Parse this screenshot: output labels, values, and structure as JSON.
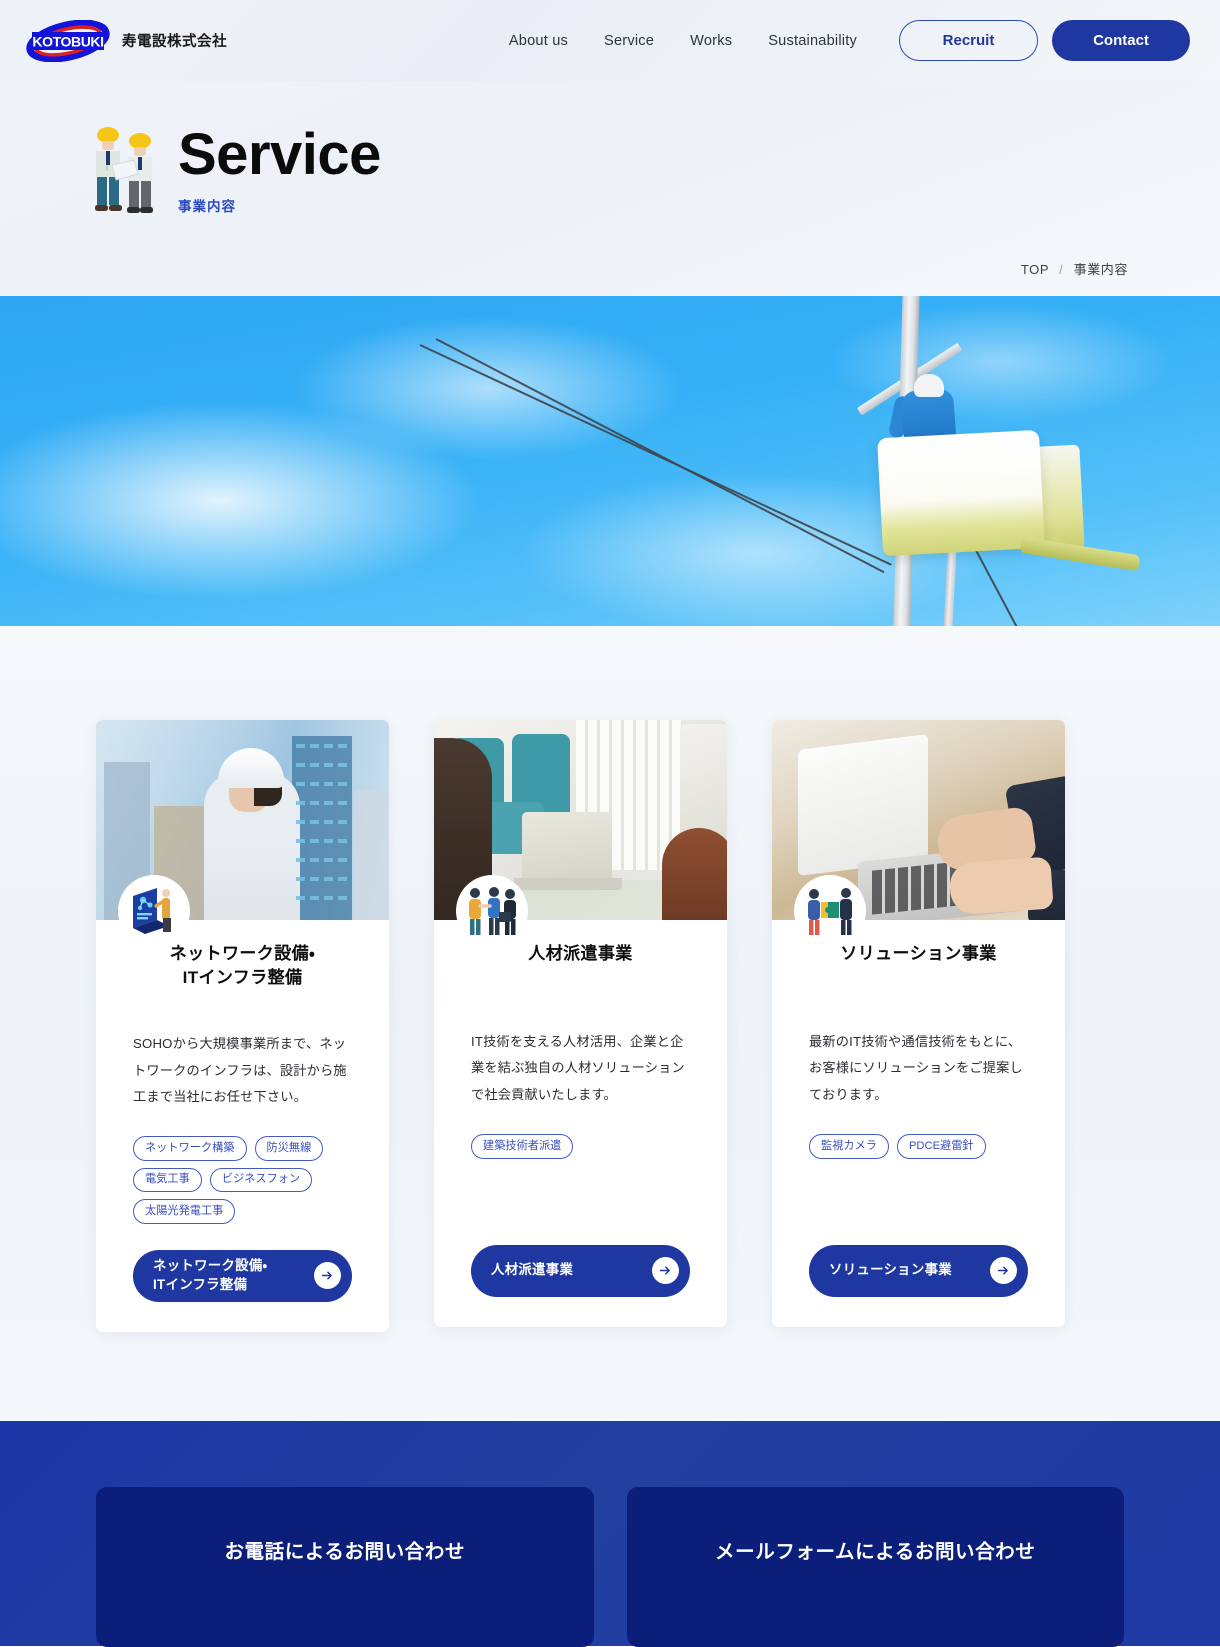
{
  "header": {
    "logo_text": "KOTOBUKI",
    "company_name": "寿電設株式会社",
    "nav": [
      {
        "label": "About us"
      },
      {
        "label": "Service"
      },
      {
        "label": "Works"
      },
      {
        "label": "Sustainability"
      }
    ],
    "recruit_label": "Recruit",
    "contact_label": "Contact"
  },
  "page_title": {
    "main": "Service",
    "sub": "事業内容"
  },
  "breadcrumb": {
    "home": "TOP",
    "separator": "/",
    "current": "事業内容"
  },
  "cards": [
    {
      "icon": "network-kiosk-icon",
      "title": "ネットワーク設備・\nITインフラ整備",
      "title_line1": "ネットワーク設備・",
      "title_line2": "ITインフラ整備",
      "description": "SOHOから大規模事業所まで、ネットワークのインフラは、設計から施工まで当社にお任せ下さい。",
      "tags": [
        "ネットワーク構築",
        "防災無線",
        "電気工事",
        "ビジネスフォン",
        "太陽光発電工事"
      ],
      "cta_line1": "ネットワーク設備・",
      "cta_line2": "ITインフラ整備",
      "photo": "worker-with-white-helmet-cityscape"
    },
    {
      "icon": "handshake-people-icon",
      "title": "人材派遣事業",
      "title_line1": "人材派遣事業",
      "title_line2": "",
      "description": "IT技術を支える人材活用、企業と企業を結ぶ独自の人材ソリューションで社会貢献いたします。",
      "tags": [
        "建築技術者派遣"
      ],
      "cta_line1": "人材派遣事業",
      "cta_line2": "",
      "photo": "meeting-room-laptop-consultation"
    },
    {
      "icon": "puzzle-people-icon",
      "title": "ソリューション事業",
      "title_line1": "ソリューション事業",
      "title_line2": "",
      "description": "最新のIT技術や通信技術をもとに、お客様にソリューションをご提案しております。",
      "tags": [
        "監視カメラ",
        "PDCE避雷針"
      ],
      "cta_line1": "ソリューション事業",
      "cta_line2": "",
      "photo": "hands-typing-on-laptop"
    }
  ],
  "contact": {
    "phone_label": "お電話によるお問い合わせ",
    "mail_label": "メールフォームによるお問い合わせ"
  },
  "colors": {
    "brand_blue": "#1f37a0",
    "accent_blue": "#2b4bbd",
    "tag_blue": "#3a4fbf",
    "contact_bg": "#1e3aa4",
    "contact_card_bg": "#0b1f7a",
    "sky_blue": "#35b0f6"
  }
}
